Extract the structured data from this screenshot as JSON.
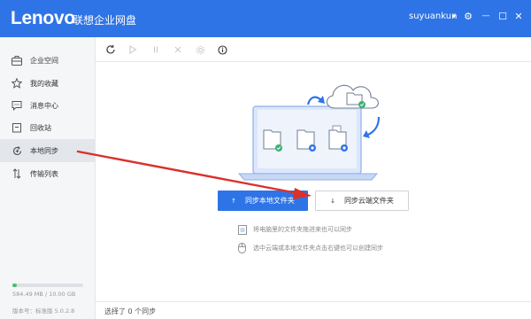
{
  "app": {
    "logo": "Lenovo",
    "title": "联想企业网盘",
    "user": "suyuankun"
  },
  "window_controls": [
    {
      "name": "user-menu-chevron-icon",
      "glyph": "▾"
    },
    {
      "name": "settings-gear-icon",
      "glyph": "⚙"
    },
    {
      "name": "minimize-icon",
      "glyph": "—"
    },
    {
      "name": "maximize-icon",
      "glyph": "☐"
    },
    {
      "name": "close-icon",
      "glyph": "✕"
    }
  ],
  "sidebar": {
    "items": [
      {
        "label": "企业空间",
        "icon": "briefcase-icon",
        "active": false
      },
      {
        "label": "我的收藏",
        "icon": "star-icon",
        "active": false
      },
      {
        "label": "消息中心",
        "icon": "message-icon",
        "active": false
      },
      {
        "label": "回收站",
        "icon": "trash-icon",
        "active": false
      },
      {
        "label": "本地同步",
        "icon": "sync-icon",
        "active": true
      },
      {
        "label": "传输列表",
        "icon": "transfer-icon",
        "active": false
      }
    ],
    "storage_text": "584.49 MB / 10.00 GB",
    "storage_fraction": 0.057,
    "version": "版本号：标准版 5.0.2.8"
  },
  "toolbar": {
    "tools": [
      "refresh-icon",
      "play-icon",
      "pause-icon",
      "cancel-icon",
      "settings-icon",
      "info-icon"
    ]
  },
  "main": {
    "primary_button": "同步本地文件夹",
    "primary_button_arrow": "↑",
    "secondary_button": "同步云端文件夹",
    "secondary_button_arrow": "↓",
    "tips": [
      "将电脑里的文件夹拖进来也可以同步",
      "选中云端或本地文件夹点击右键也可以创建同步"
    ]
  },
  "status": {
    "text": "选择了 0 个同步"
  },
  "colors": {
    "brand": "#2e74e6",
    "success": "#3bb273",
    "annotation": "#d9312b"
  }
}
